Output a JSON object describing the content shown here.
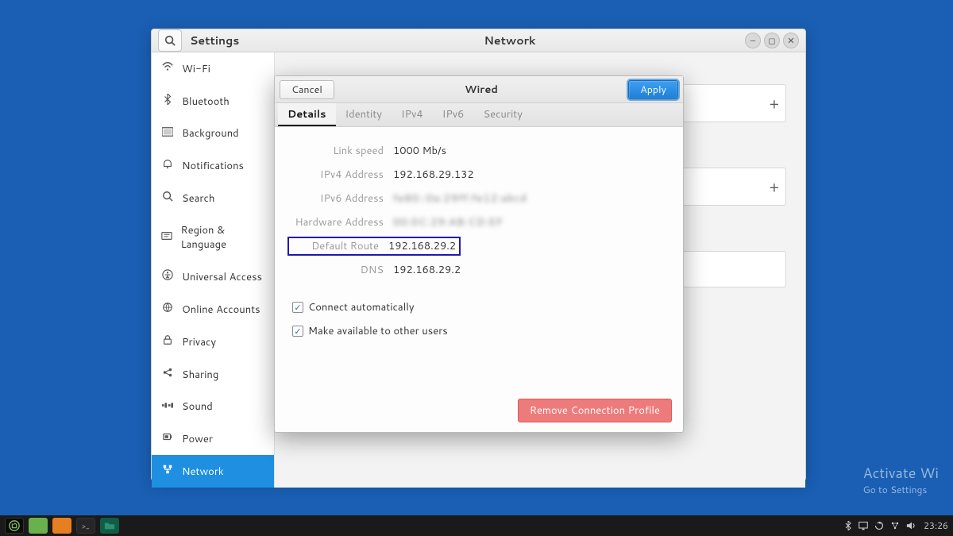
{
  "titlebar": {
    "section_title": "Settings",
    "page_title": "Network"
  },
  "sidebar": {
    "items": [
      {
        "icon": "wifi",
        "label": "Wi-Fi"
      },
      {
        "icon": "bluetooth",
        "label": "Bluetooth"
      },
      {
        "icon": "background",
        "label": "Background"
      },
      {
        "icon": "notifications",
        "label": "Notifications"
      },
      {
        "icon": "search",
        "label": "Search"
      },
      {
        "icon": "region",
        "label": "Region & Language"
      },
      {
        "icon": "universal",
        "label": "Universal Access"
      },
      {
        "icon": "online",
        "label": "Online Accounts"
      },
      {
        "icon": "privacy",
        "label": "Privacy"
      },
      {
        "icon": "sharing",
        "label": "Sharing"
      },
      {
        "icon": "sound",
        "label": "Sound"
      },
      {
        "icon": "power",
        "label": "Power"
      },
      {
        "icon": "network",
        "label": "Network"
      }
    ],
    "active_index": 12
  },
  "dialog": {
    "cancel_label": "Cancel",
    "title": "Wired",
    "apply_label": "Apply",
    "tabs": [
      "Details",
      "Identity",
      "IPv4",
      "IPv6",
      "Security"
    ],
    "active_tab": 0,
    "details": {
      "link_speed_label": "Link speed",
      "link_speed_value": "1000 Mb/s",
      "ipv4_label": "IPv4 Address",
      "ipv4_value": "192.168.29.132",
      "ipv6_label": "IPv6 Address",
      "ipv6_value": "fe80::0a:29ff:fe12:abcd",
      "hw_label": "Hardware Address",
      "hw_value": "00:0C:29:AB:CD:EF",
      "route_label": "Default Route",
      "route_value": "192.168.29.2",
      "dns_label": "DNS",
      "dns_value": "192.168.29.2"
    },
    "connect_auto_label": "Connect automatically",
    "connect_auto_checked": true,
    "make_avail_label": "Make available to other users",
    "make_avail_checked": true,
    "remove_label": "Remove Connection Profile"
  },
  "watermark": {
    "line1": "Activate Wi",
    "line2": "Go to Settings"
  },
  "taskbar": {
    "clock": "23:26"
  }
}
